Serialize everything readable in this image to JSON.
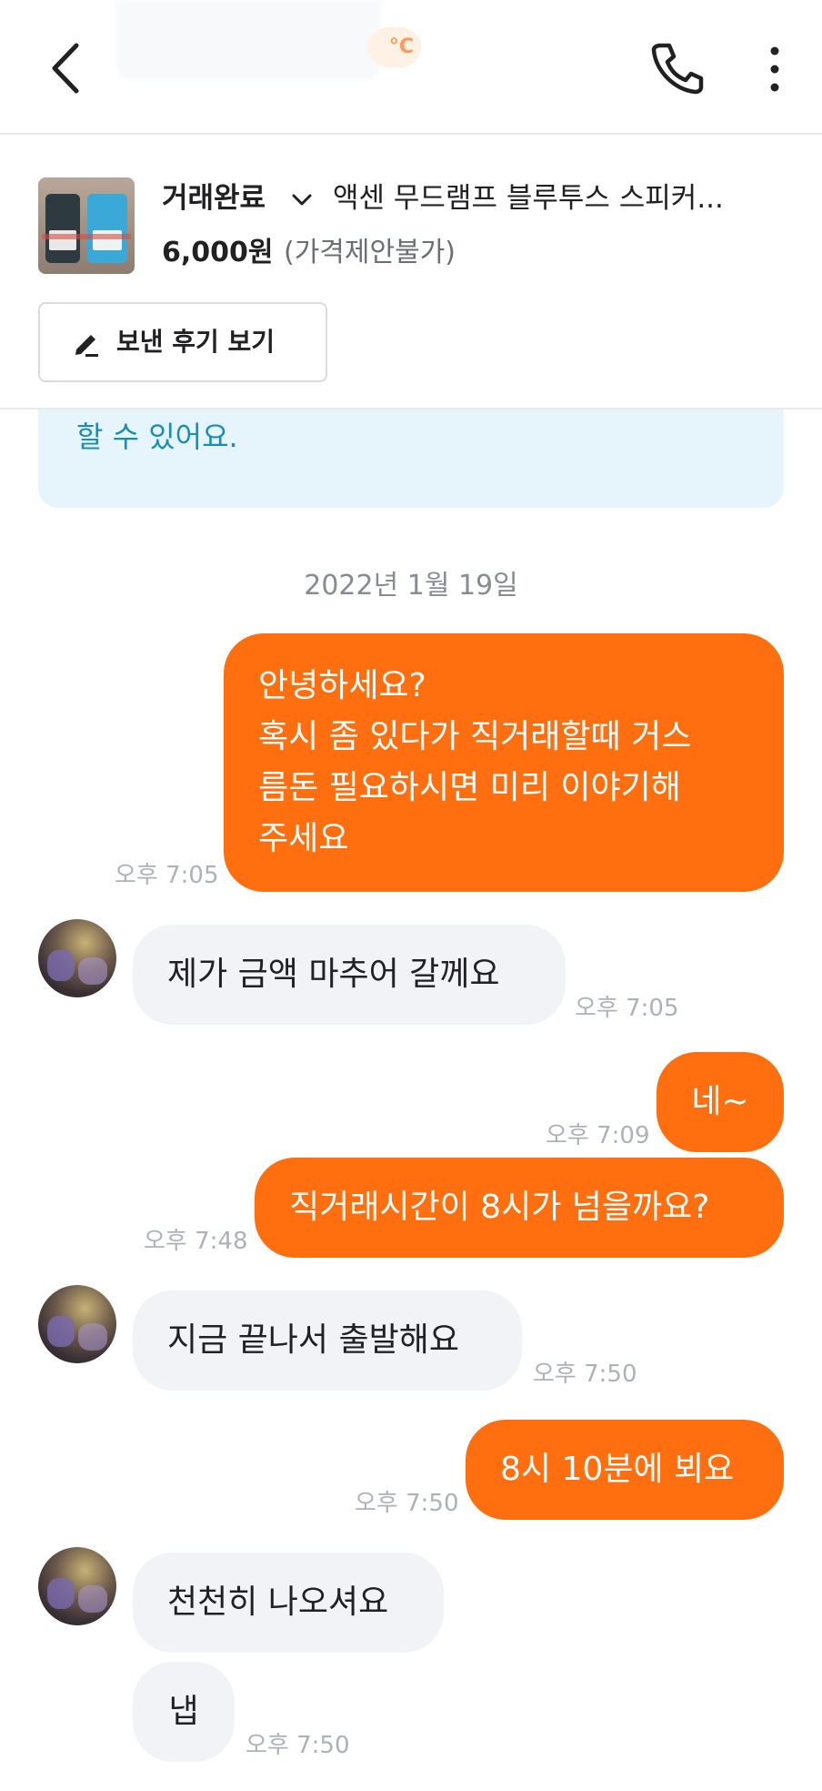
{
  "header": {
    "temperature_badge": "°C"
  },
  "product": {
    "status": "거래완료",
    "title": "액센 무드램프 블루투스 스피커...",
    "price": "6,000원",
    "price_note": "(가격제안불가)",
    "review_button": "보낸 후기 보기"
  },
  "notice": {
    "text": "할 수 있어요."
  },
  "chat": {
    "date": "2022년 1월 19일",
    "messages": [
      {
        "from": "me",
        "lines": [
          "안녕하세요?",
          "혹시 좀 있다가 직거래할때 거스",
          "름돈 필요하시면 미리 이야기해",
          "주세요"
        ],
        "time": "오후 7:05"
      },
      {
        "from": "them",
        "lines": [
          "제가 금액 마추어 갈께요"
        ],
        "time": "오후 7:05"
      },
      {
        "from": "me",
        "lines": [
          "네~"
        ],
        "time": "오후 7:09"
      },
      {
        "from": "me",
        "lines": [
          "직거래시간이 8시가 넘을까요?"
        ],
        "time": "오후 7:48"
      },
      {
        "from": "them",
        "lines": [
          "지금 끝나서 출발해요"
        ],
        "time": "오후 7:50"
      },
      {
        "from": "me",
        "lines": [
          "8시 10분에 뵈요"
        ],
        "time": "오후 7:50"
      },
      {
        "from": "them",
        "lines": [
          "천천히 나오셔요"
        ],
        "time": ""
      },
      {
        "from": "them",
        "lines": [
          "냅"
        ],
        "time": "오후 7:50"
      }
    ]
  },
  "colors": {
    "accent": "#ff6f0f",
    "other_bubble": "#f2f3f6",
    "notice_bg": "#e6f5fb",
    "notice_text": "#1b8db5"
  },
  "icons": [
    "back-icon",
    "phone-icon",
    "more-icon",
    "chevron-down-icon",
    "pencil-icon"
  ]
}
